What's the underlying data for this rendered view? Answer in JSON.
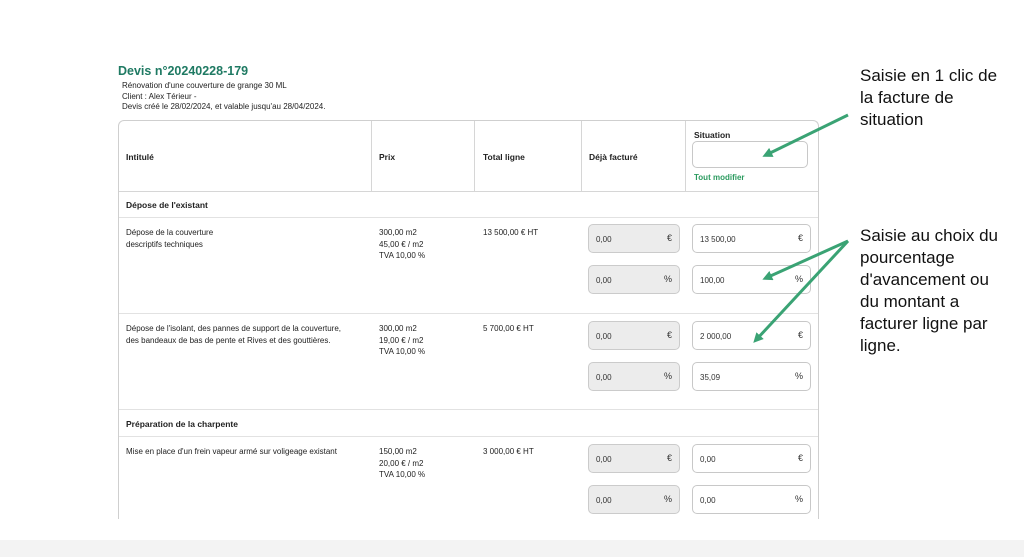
{
  "quote": {
    "title": "Devis n°20240228-179",
    "description": "Rénovation d'une couverture de grange 30 ML",
    "client": "Client : Alex Térieur -",
    "validity": "Devis créé le 28/02/2024, et valable jusqu'au 28/04/2024."
  },
  "table": {
    "headers": {
      "intitule": "Intitulé",
      "prix": "Prix",
      "total": "Total ligne",
      "deja": "Déjà facturé",
      "situation": "Situation"
    },
    "tout_modifier": "Tout modifier",
    "sections": [
      {
        "title": "Dépose de l'existant",
        "items": [
          {
            "label_1": "Dépose de la couverture",
            "label_2": "descriptifs techniques",
            "qty": "300,00 m2",
            "unit_price": "45,00 € / m2",
            "tva": "TVA 10,00 %",
            "total": "13 500,00 € HT",
            "billed_amount": "0,00",
            "billed_percent": "0,00",
            "situation_amount": "13 500,00",
            "situation_percent": "100,00"
          },
          {
            "label_1": "Dépose de l'isolant, des pannes de support de la couverture,",
            "label_2": "des bandeaux de bas de pente et Rives et des gouttières.",
            "qty": "300,00 m2",
            "unit_price": "19,00 € / m2",
            "tva": "TVA 10,00 %",
            "total": "5 700,00 € HT",
            "billed_amount": "0,00",
            "billed_percent": "0,00",
            "situation_amount": "2 000,00",
            "situation_percent": "35,09"
          }
        ]
      },
      {
        "title": "Préparation de la charpente",
        "items": [
          {
            "label_1": "Mise en place d'un frein vapeur armé sur voligeage existant",
            "label_2": "",
            "qty": "150,00 m2",
            "unit_price": "20,00 € / m2",
            "tva": "TVA 10,00 %",
            "total": "3 000,00 € HT",
            "billed_amount": "0,00",
            "billed_percent": "0,00",
            "situation_amount": "0,00",
            "situation_percent": "0,00"
          }
        ]
      }
    ],
    "units": {
      "currency": "€",
      "percent": "%"
    }
  },
  "annotations": {
    "one_click": [
      "Saisie en 1 clic de",
      "la facture de",
      "situation"
    ],
    "per_line": [
      "Saisie au choix du",
      "pourcentage",
      "d'avancement ou",
      "du montant a",
      "facturer ligne par",
      "ligne."
    ]
  },
  "colors": {
    "brand": "#1f7a63",
    "link": "#2b9b5f",
    "arrow": "#3aa374"
  }
}
